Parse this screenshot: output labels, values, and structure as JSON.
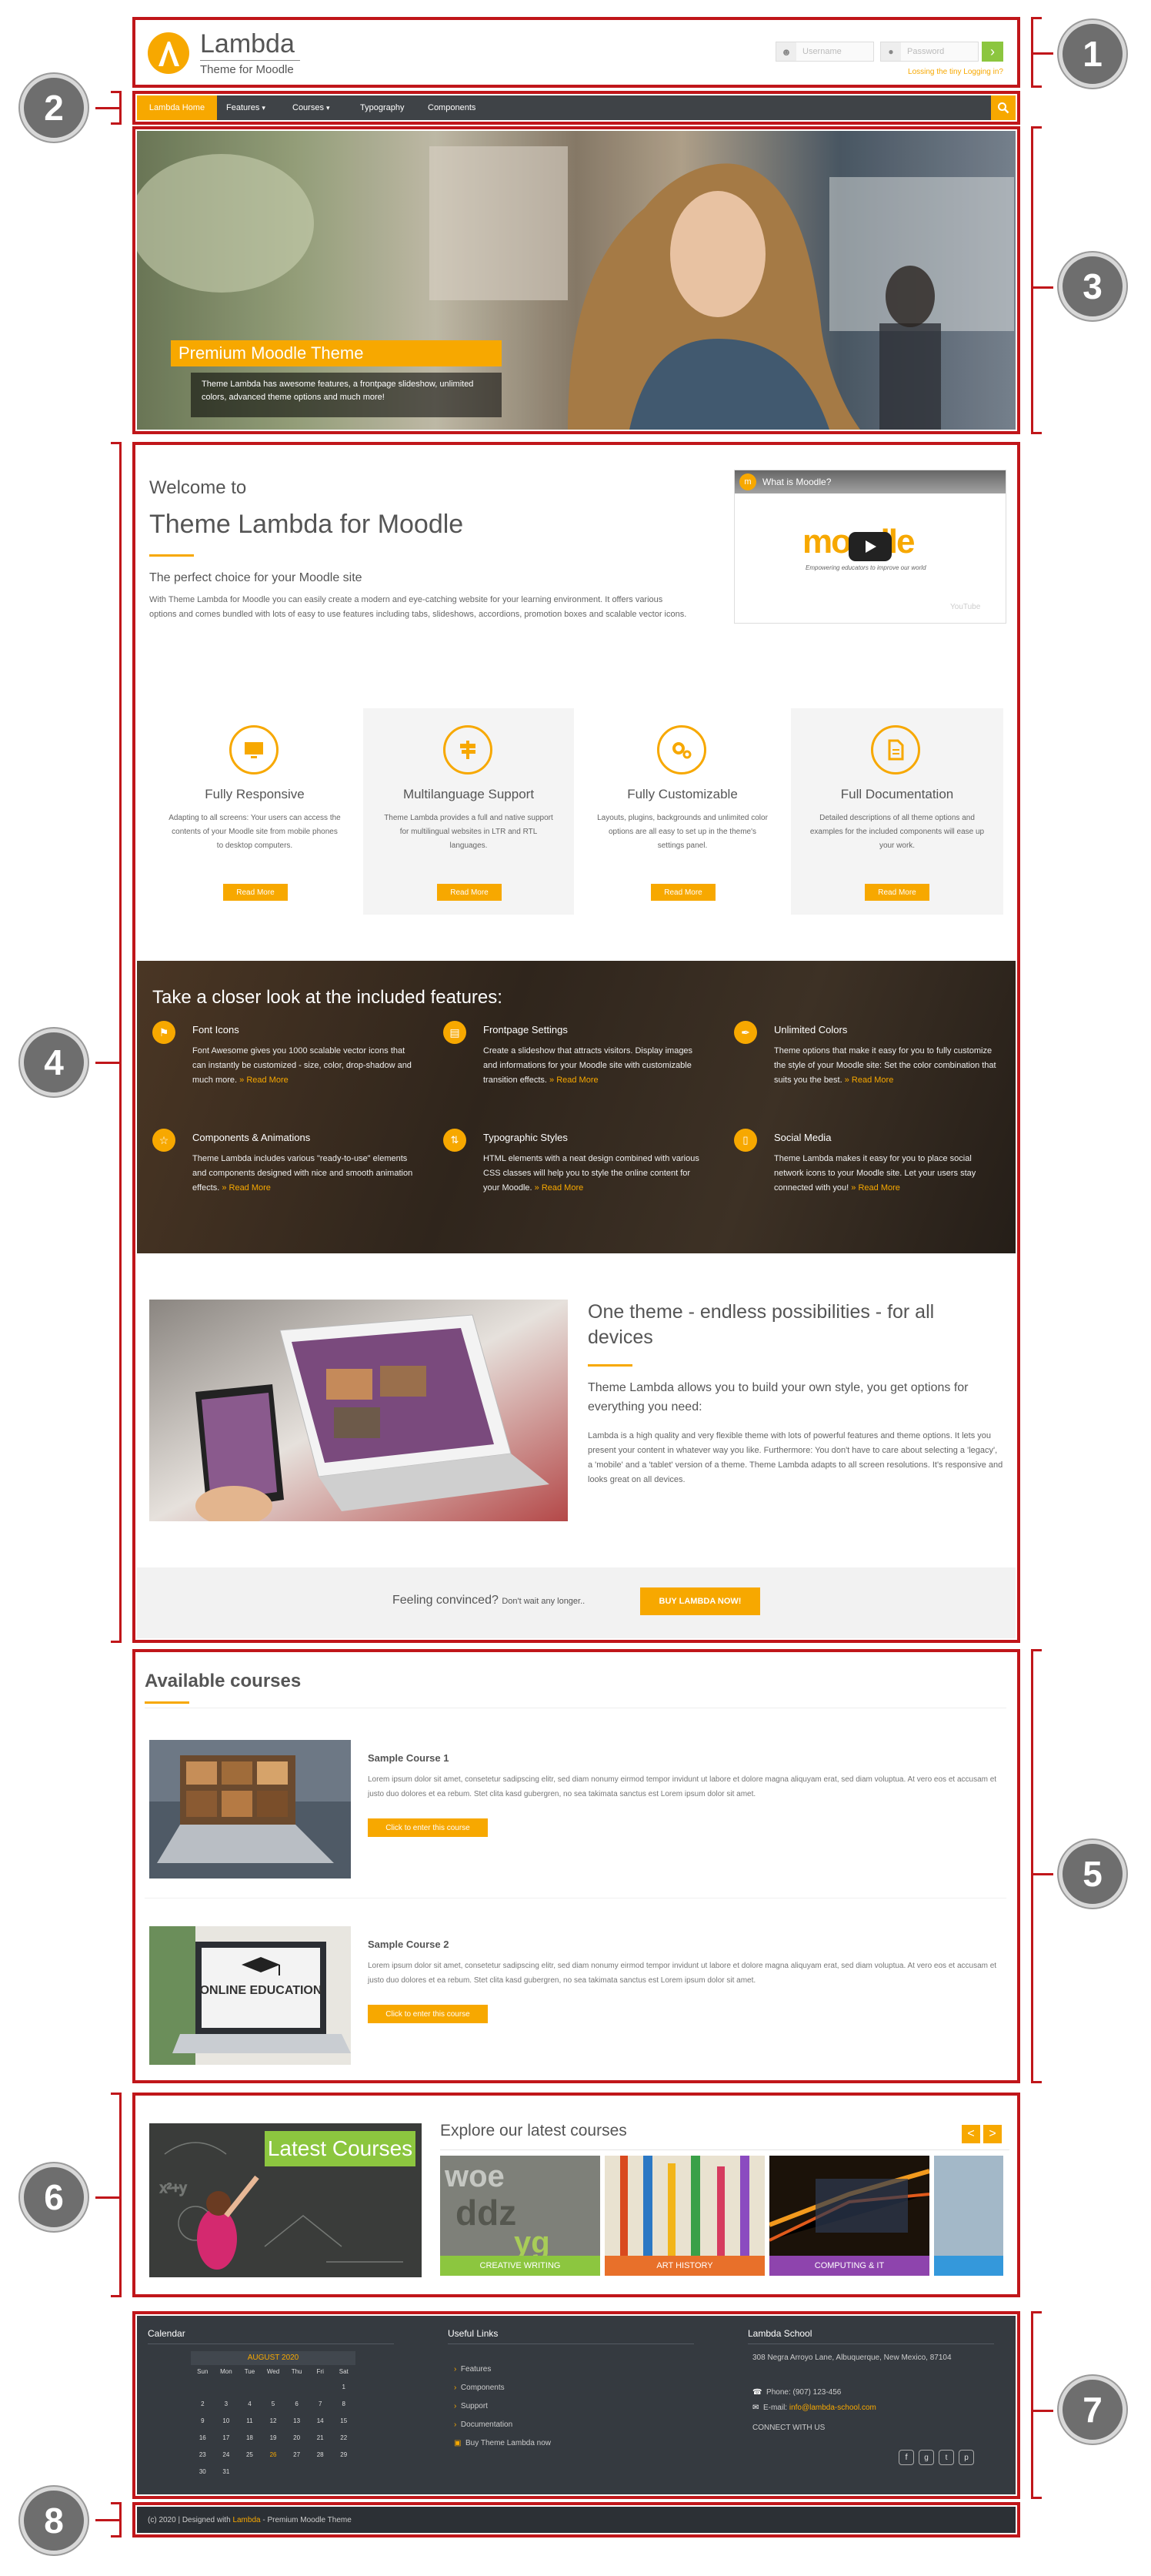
{
  "callouts": [
    "1",
    "2",
    "3",
    "4",
    "5",
    "6",
    "7",
    "8"
  ],
  "colors": {
    "accent": "#f7a800",
    "annotation": "#c0161a",
    "navbar": "#3f4347",
    "footer": "#353a40",
    "copyright_bar": "#2c3035",
    "login_button": "#8cc63f",
    "features_band": "#3b2e22"
  },
  "header": {
    "logo_title": "Lambda",
    "logo_subtitle": "Theme for Moodle",
    "username_placeholder": "Username",
    "password_placeholder": "Password",
    "login_go": "›",
    "lost_password": "Lossing the tiny Logging in?"
  },
  "nav": {
    "items": [
      "Lambda Home",
      "Features",
      "Courses",
      "Typography",
      "Components"
    ],
    "dropdown_marker": "▾"
  },
  "slider": {
    "caption_title": "Premium Moodle Theme",
    "caption_text": "Theme Lambda has awesome features, a frontpage slideshow, unlimited colors, advanced theme options and much more!"
  },
  "intro": {
    "welcome": "Welcome to",
    "title": "Theme Lambda for Moodle",
    "subtitle": "The perfect choice for your Moodle site",
    "text": "With Theme Lambda for Moodle you can easily create a modern and eye-catching website for your learning environment. It offers various options and comes bundled with lots of easy to use features including tabs, slideshows, accordions, promotion boxes and scalable vector icons.",
    "video_title": "What is Moodle?",
    "video_brand": "moodle",
    "video_tagline": "Empowering educators to improve our world",
    "video_badge": "YouTube"
  },
  "features": [
    {
      "icon": "monitor-icon",
      "title": "Fully Responsive",
      "text": "Adapting to all screens: Your users can access the contents of your Moodle site from mobile phones to desktop computers.",
      "button": "Read More"
    },
    {
      "icon": "signpost-icon",
      "title": "Multilanguage Support",
      "text": "Theme Lambda provides a full and native support for multilingual websites in LTR and RTL languages.",
      "button": "Read More"
    },
    {
      "icon": "gears-icon",
      "title": "Fully Customizable",
      "text": "Layouts, plugins, backgrounds and unlimited color options are all easy to set up in the theme's settings panel.",
      "button": "Read More"
    },
    {
      "icon": "document-icon",
      "title": "Full Documentation",
      "text": "Detailed descriptions of all theme options and examples for the included components will ease up your work.",
      "button": "Read More"
    }
  ],
  "closer": {
    "title": "Take a closer look at the included features:",
    "read_more": "» Read More",
    "items": [
      {
        "icon": "flag-icon",
        "title": "Font Icons",
        "text": "Font Awesome gives you 1000 scalable vector icons that can instantly be customized - size, color, drop-shadow and much more."
      },
      {
        "icon": "picture-icon",
        "title": "Frontpage Settings",
        "text": "Create a slideshow that attracts visitors. Display images and informations for your Moodle site with customizable transition effects."
      },
      {
        "icon": "brush-icon",
        "title": "Unlimited Colors",
        "text": "Theme options that make it easy for you to fully customize the style of your Moodle site: Set the color combination that suits you the best."
      },
      {
        "icon": "star-icon",
        "title": "Components & Animations",
        "text": "Theme Lambda includes various \"ready-to-use\" elements and components designed with nice and smooth animation effects."
      },
      {
        "icon": "text-height-icon",
        "title": "Typographic Styles",
        "text": "HTML elements with a neat design combined with various CSS classes will help you to style the online content for your Moodle."
      },
      {
        "icon": "mobile-icon",
        "title": "Social Media",
        "text": "Theme Lambda makes it easy for you to place social network icons to your Moodle site. Let your users stay connected with you!"
      }
    ]
  },
  "endless": {
    "title": "One theme - endless possibilities - for all devices",
    "subtitle": "Theme Lambda allows you to build your own style, you get options for everything you need:",
    "text": "Lambda is a high quality and very flexible theme with lots of powerful features and theme options. It lets you present your content in whatever way you like. Furthermore: You don't have to care about selecting a 'legacy', a 'mobile' and a 'tablet' version of a theme. Theme Lambda adapts to all screen resolutions. It's responsive and looks great on all devices."
  },
  "convinced": {
    "lead": "Feeling convinced?",
    "small": "Don't wait any longer..",
    "button": "BUY LAMBDA NOW!"
  },
  "courses": {
    "heading": "Available courses",
    "button": "Click to enter this course",
    "items": [
      {
        "title": "Sample Course 1",
        "text": "Lorem ipsum dolor sit amet, consetetur sadipscing elitr, sed diam nonumy eirmod tempor invidunt ut labore et dolore magna aliquyam erat, sed diam voluptua. At vero eos et accusam et justo duo dolores et ea rebum. Stet clita kasd gubergren, no sea takimata sanctus est Lorem ipsum dolor sit amet."
      },
      {
        "title": "Sample Course 2",
        "text": "Lorem ipsum dolor sit amet, consetetur sadipscing elitr, sed diam nonumy eirmod tempor invidunt ut labore et dolore magna aliquyam erat, sed diam voluptua. At vero eos et accusam et justo duo dolores et ea rebum. Stet clita kasd gubergren, no sea takimata sanctus est Lorem ipsum dolor sit amet.",
        "image_text": "ONLINE EDUCATION"
      }
    ]
  },
  "latest": {
    "banner": "Latest Courses",
    "heading": "Explore our latest courses",
    "prev": "<",
    "next": ">",
    "cards": [
      {
        "label": "CREATIVE WRITING",
        "color": "#8cc63f"
      },
      {
        "label": "ART HISTORY",
        "color": "#e8702a"
      },
      {
        "label": "COMPUTING & IT",
        "color": "#8e44ad"
      }
    ]
  },
  "footer": {
    "calendar": {
      "title": "Calendar",
      "month": "AUGUST 2020",
      "weekdays": [
        "Sun",
        "Mon",
        "Tue",
        "Wed",
        "Thu",
        "Fri",
        "Sat"
      ],
      "weeks": [
        [
          "",
          "",
          "",
          "",
          "",
          "",
          "1"
        ],
        [
          "2",
          "3",
          "4",
          "5",
          "6",
          "7",
          "8"
        ],
        [
          "9",
          "10",
          "11",
          "12",
          "13",
          "14",
          "15"
        ],
        [
          "16",
          "17",
          "18",
          "19",
          "20",
          "21",
          "22"
        ],
        [
          "23",
          "24",
          "25",
          "26",
          "27",
          "28",
          "29"
        ],
        [
          "30",
          "31",
          "",
          "",
          "",
          "",
          ""
        ]
      ]
    },
    "links": {
      "title": "Useful Links",
      "items": [
        "Features",
        "Components",
        "Support",
        "Documentation"
      ],
      "buy": "Buy Theme Lambda now"
    },
    "school": {
      "title": "Lambda School",
      "address": "308 Negra Arroyo Lane, Albuquerque, New Mexico, 87104",
      "phone_label": "Phone:",
      "phone": "(907) 123-456",
      "email_label": "E-mail:",
      "email": "info@lambda-school.com",
      "connect": "CONNECT WITH US"
    }
  },
  "copyright": {
    "prefix": "(c) 2020 | Designed with",
    "brand": "Lambda",
    "suffix": "- Premium Moodle Theme"
  }
}
